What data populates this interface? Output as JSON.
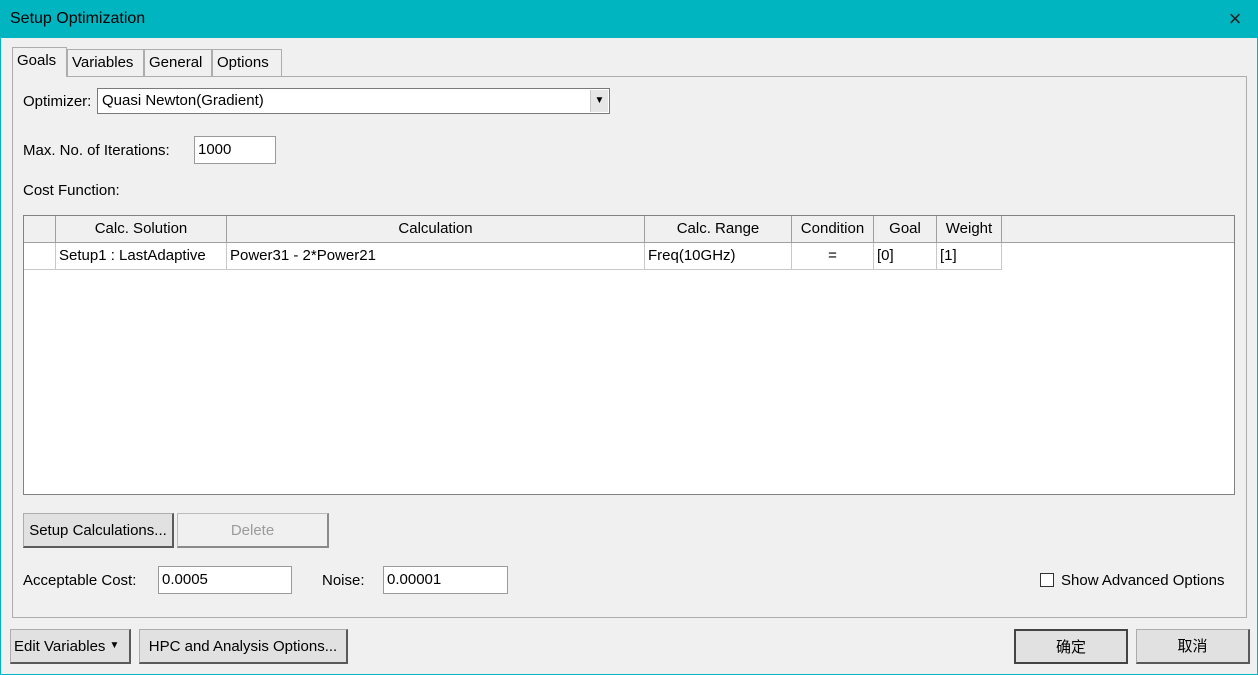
{
  "window": {
    "title": "Setup Optimization",
    "close_icon": "×"
  },
  "tabs": [
    {
      "label": "Goals",
      "active": true
    },
    {
      "label": "Variables",
      "active": false
    },
    {
      "label": "General",
      "active": false
    },
    {
      "label": "Options",
      "active": false
    }
  ],
  "optimizer": {
    "label": "Optimizer:",
    "value": "Quasi Newton(Gradient)"
  },
  "iterations": {
    "label": "Max. No. of Iterations:",
    "value": "1000"
  },
  "cost_function": {
    "label": "Cost Function:",
    "columns": [
      "",
      "Calc. Solution",
      "Calculation",
      "Calc. Range",
      "Condition",
      "Goal",
      "Weight"
    ],
    "rows": [
      {
        "index": "",
        "solution": "Setup1 : LastAdaptive",
        "calculation": "Power31 - 2*Power21",
        "range": "Freq(10GHz)",
        "condition": "=",
        "goal": "[0]",
        "weight": "[1]"
      }
    ]
  },
  "buttons": {
    "setup_calculations": "Setup Calculations...",
    "delete": "Delete",
    "edit_variables": "Edit Variables",
    "hpc": "HPC and Analysis Options...",
    "ok": "确定",
    "cancel": "取消"
  },
  "acceptable_cost": {
    "label": "Acceptable Cost:",
    "value": "0.0005"
  },
  "noise": {
    "label": "Noise:",
    "value": "0.00001"
  },
  "advanced": {
    "label": "Show Advanced Options",
    "checked": false
  },
  "colors": {
    "titlebar": "#00b4c0"
  }
}
